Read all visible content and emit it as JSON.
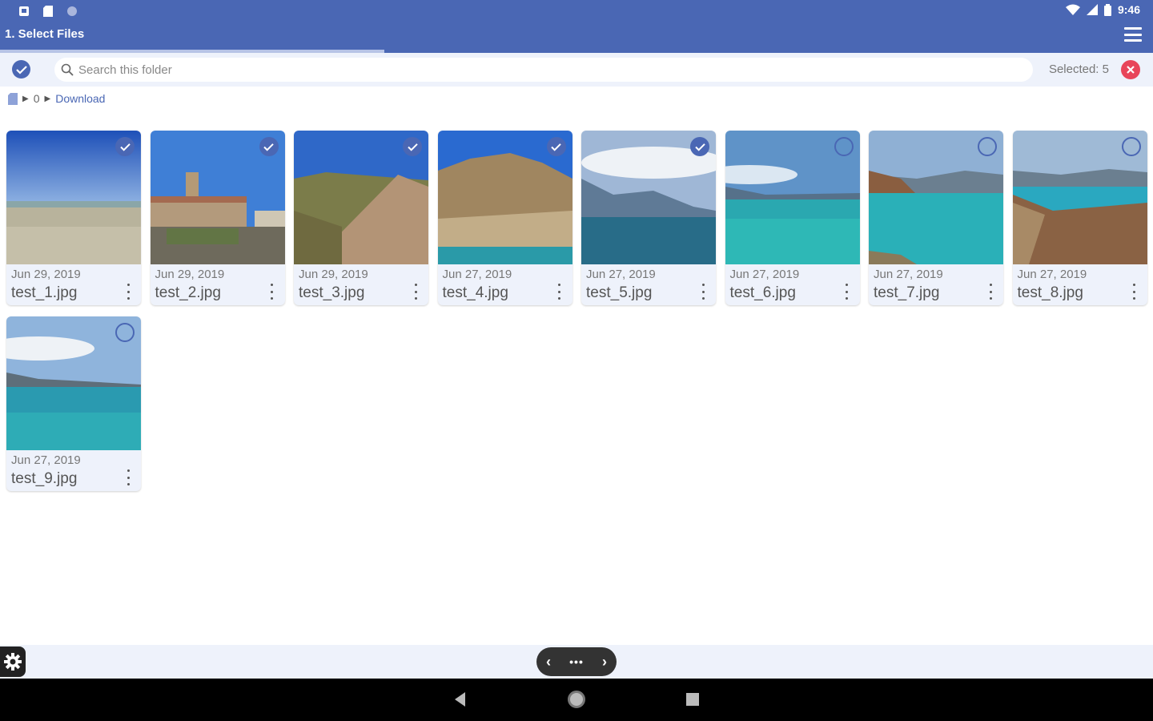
{
  "status_bar": {
    "time": "9:46"
  },
  "app_bar": {
    "title": "1. Select Files",
    "progress": 0.333
  },
  "search": {
    "placeholder": "Search this folder",
    "value": ""
  },
  "selection": {
    "label": "Selected: 5"
  },
  "breadcrumb": {
    "items": [
      "0",
      "Download"
    ]
  },
  "files": [
    {
      "date": "Jun 29, 2019",
      "name": "test_1.jpg",
      "selected": true
    },
    {
      "date": "Jun 29, 2019",
      "name": "test_2.jpg",
      "selected": true
    },
    {
      "date": "Jun 29, 2019",
      "name": "test_3.jpg",
      "selected": true
    },
    {
      "date": "Jun 27, 2019",
      "name": "test_4.jpg",
      "selected": true
    },
    {
      "date": "Jun 27, 2019",
      "name": "test_5.jpg",
      "selected": true
    },
    {
      "date": "Jun 27, 2019",
      "name": "test_6.jpg",
      "selected": false
    },
    {
      "date": "Jun 27, 2019",
      "name": "test_7.jpg",
      "selected": false
    },
    {
      "date": "Jun 27, 2019",
      "name": "test_8.jpg",
      "selected": false
    },
    {
      "date": "Jun 27, 2019",
      "name": "test_9.jpg",
      "selected": false
    }
  ],
  "pager": {
    "prev": "‹",
    "dots": "•••",
    "next": "›"
  },
  "colors": {
    "primary": "#4a67b4",
    "surface": "#eef2fb",
    "danger": "#e8455a"
  }
}
